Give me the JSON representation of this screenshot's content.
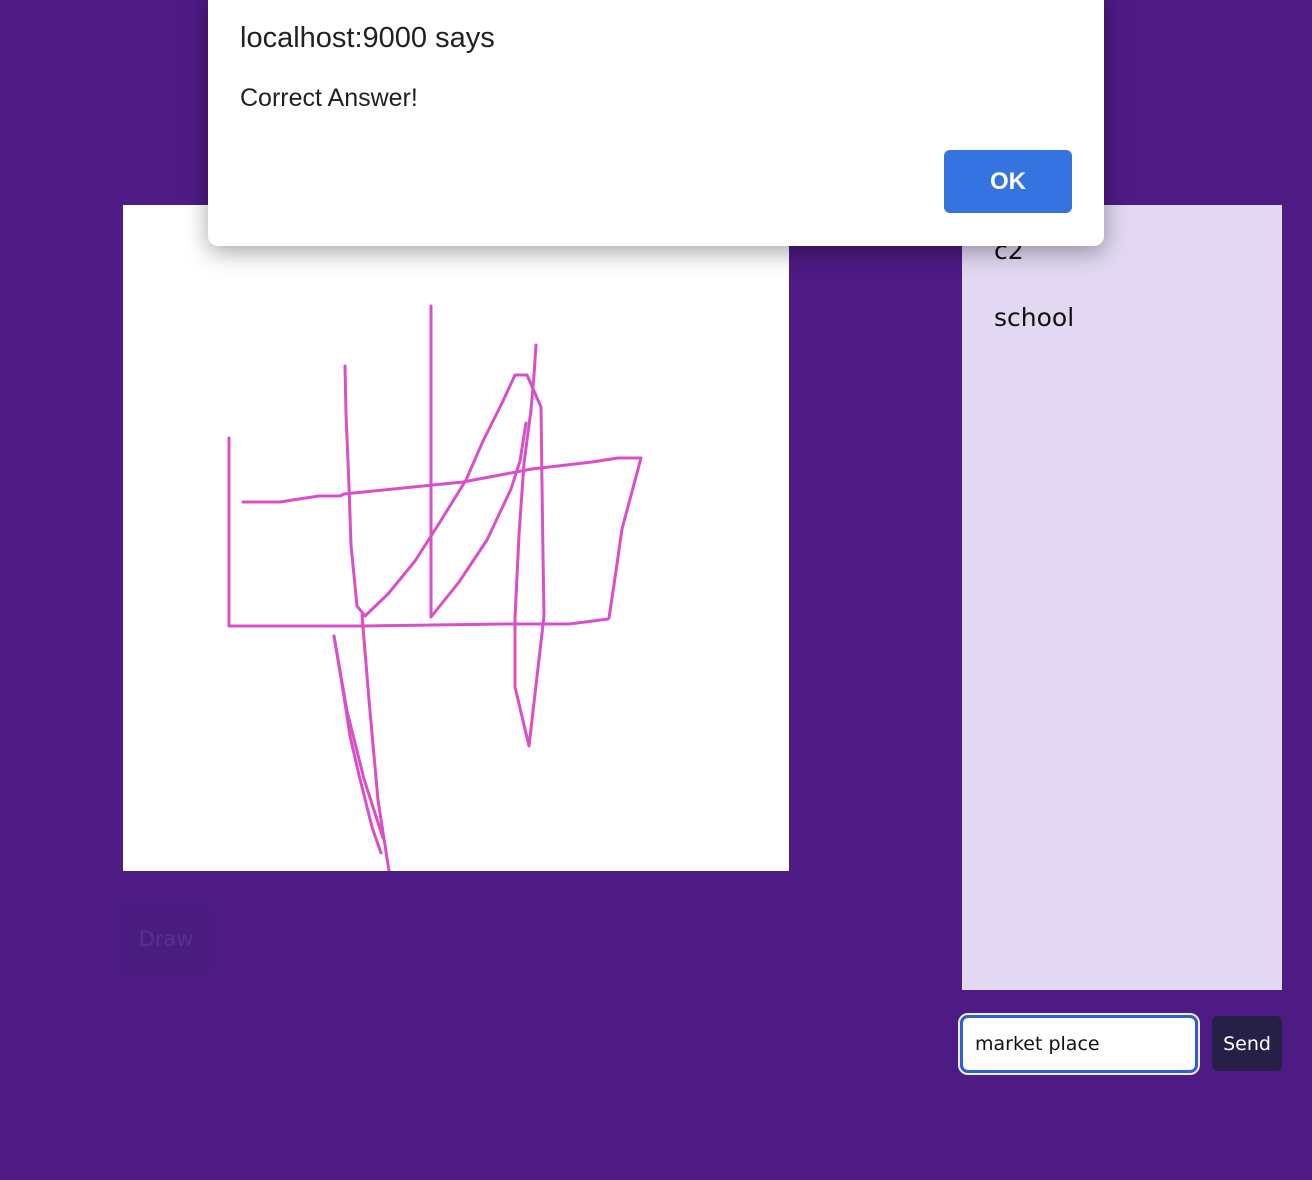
{
  "colors": {
    "page_background": "#4e1a84",
    "stroke": "#d94fc8",
    "chat_background": "#e2d8f2",
    "ok_button": "#3574e0",
    "send_button": "#262046"
  },
  "alert": {
    "title": "localhost:9000 says",
    "message": "Correct Answer!",
    "ok_label": "OK"
  },
  "canvas": {
    "draw_label": "Draw"
  },
  "chat": {
    "messages": [
      {
        "text": "c2"
      },
      {
        "text": "school"
      }
    ]
  },
  "guess": {
    "value": "market place",
    "send_label": "Send"
  }
}
